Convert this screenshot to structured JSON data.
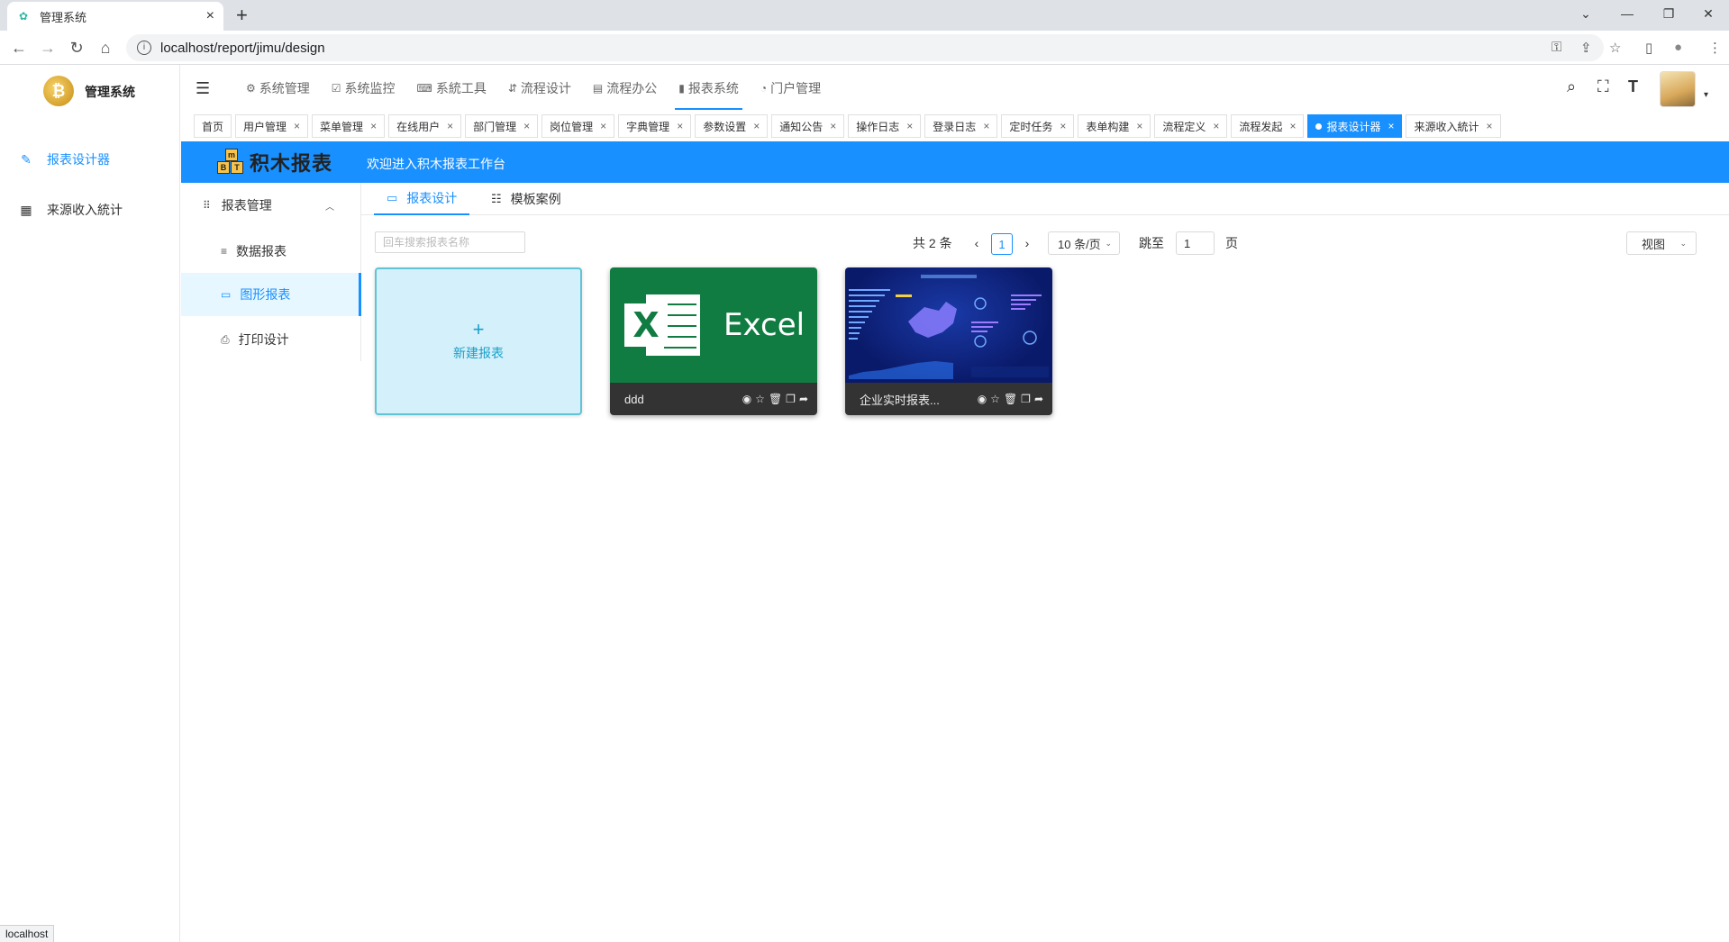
{
  "browser": {
    "tab_title": "管理系统",
    "url": "localhost/report/jimu/design",
    "status_text": "localhost",
    "icons": {
      "new_tab": "+",
      "close_tab": "×",
      "minimize": "—",
      "maximize": "❐",
      "close_window": "✕",
      "back": "←",
      "forward": "→",
      "reload": "↻",
      "home": "⌂",
      "info": "i",
      "key": "⚿",
      "share": "⇪",
      "bookmark": "☆",
      "sidepanel": "▯",
      "profile": "●",
      "menu": "⋮",
      "tabs_dropdown": "⌄"
    }
  },
  "sidebar": {
    "app_name": "管理系统",
    "logo_text": "₿",
    "items": [
      {
        "label": "报表设计器",
        "icon": "edit-icon",
        "glyph": "✎",
        "active": true
      },
      {
        "label": "来源收入統计",
        "icon": "table-icon",
        "glyph": "▦",
        "active": false
      }
    ]
  },
  "header": {
    "menu_toggle_glyph": "☰",
    "menus": [
      {
        "label": "系统管理",
        "glyph": "⚙"
      },
      {
        "label": "系统监控",
        "glyph": "☑"
      },
      {
        "label": "系統工具",
        "glyph": "⌨"
      },
      {
        "label": "流程设计",
        "glyph": "⇵"
      },
      {
        "label": "流程办公",
        "glyph": "▤"
      },
      {
        "label": "报表系统",
        "glyph": "▮"
      },
      {
        "label": "门户管理",
        "glyph": "◔"
      }
    ],
    "search_glyph": "⌕",
    "fullscreen_glyph": "⛶",
    "fontsize_glyph": "T",
    "caret_glyph": "▾"
  },
  "tags": [
    {
      "label": "首页",
      "closable": false
    },
    {
      "label": "用户管理",
      "closable": true
    },
    {
      "label": "菜单管理",
      "closable": true
    },
    {
      "label": "在线用户",
      "closable": true
    },
    {
      "label": "部门管理",
      "closable": true
    },
    {
      "label": "岗位管理",
      "closable": true
    },
    {
      "label": "字典管理",
      "closable": true
    },
    {
      "label": "参数设置",
      "closable": true
    },
    {
      "label": "通知公告",
      "closable": true
    },
    {
      "label": "操作日志",
      "closable": true
    },
    {
      "label": "登录日志",
      "closable": true
    },
    {
      "label": "定时任务",
      "closable": true
    },
    {
      "label": "表单构建",
      "closable": true
    },
    {
      "label": "流程定义",
      "closable": true
    },
    {
      "label": "流程发起",
      "closable": true
    },
    {
      "label": "报表设计器",
      "closable": true,
      "active": true
    },
    {
      "label": "来源收入統计",
      "closable": true
    }
  ],
  "tag_close_glyph": "×",
  "banner": {
    "logo_text": "积木报表",
    "logo_blocks": [
      "m",
      "B",
      "T"
    ],
    "welcome": "欢迎进入积木报表工作台"
  },
  "report_menu": {
    "header": "报表管理",
    "header_glyph": "⠿",
    "collapse_glyph": "︿",
    "items": [
      {
        "label": "数据报表",
        "glyph": "≡",
        "active": false
      },
      {
        "label": "图形报表",
        "glyph": "▭",
        "active": true
      },
      {
        "label": "打印设计",
        "glyph": "⎙",
        "active": false
      }
    ]
  },
  "content_tabs": [
    {
      "label": "报表设计",
      "glyph": "▭",
      "active": true
    },
    {
      "label": "模板案例",
      "glyph": "☷",
      "active": false
    }
  ],
  "search": {
    "placeholder": "回车搜索报表名称",
    "value": ""
  },
  "pagination": {
    "total": "共 2 条",
    "prev_glyph": "‹",
    "next_glyph": "›",
    "current": "1",
    "page_size": "10 条/页",
    "jump_label": "跳至",
    "jump_value": "1",
    "page_suffix": "页",
    "dropdown_glyph": "⌄"
  },
  "view_select": {
    "label": "视图"
  },
  "cards": {
    "new_plus": "+",
    "new_label": "新建报表",
    "action_glyphs": [
      "◉",
      "☆",
      "🗑",
      "❐",
      "➦"
    ],
    "items": [
      {
        "name": "ddd",
        "thumb_word": "Excel",
        "thumb_letter": "X",
        "thumbnail": "excel-logo"
      },
      {
        "name": "企业实时报表...",
        "thumbnail": "dashboard-preview"
      }
    ]
  },
  "colors": {
    "primary": "#1890ff",
    "banner": "#1890ff",
    "excel_green": "#107c41",
    "card_footer": "#333333",
    "new_card_bg": "#d4f0fb"
  }
}
